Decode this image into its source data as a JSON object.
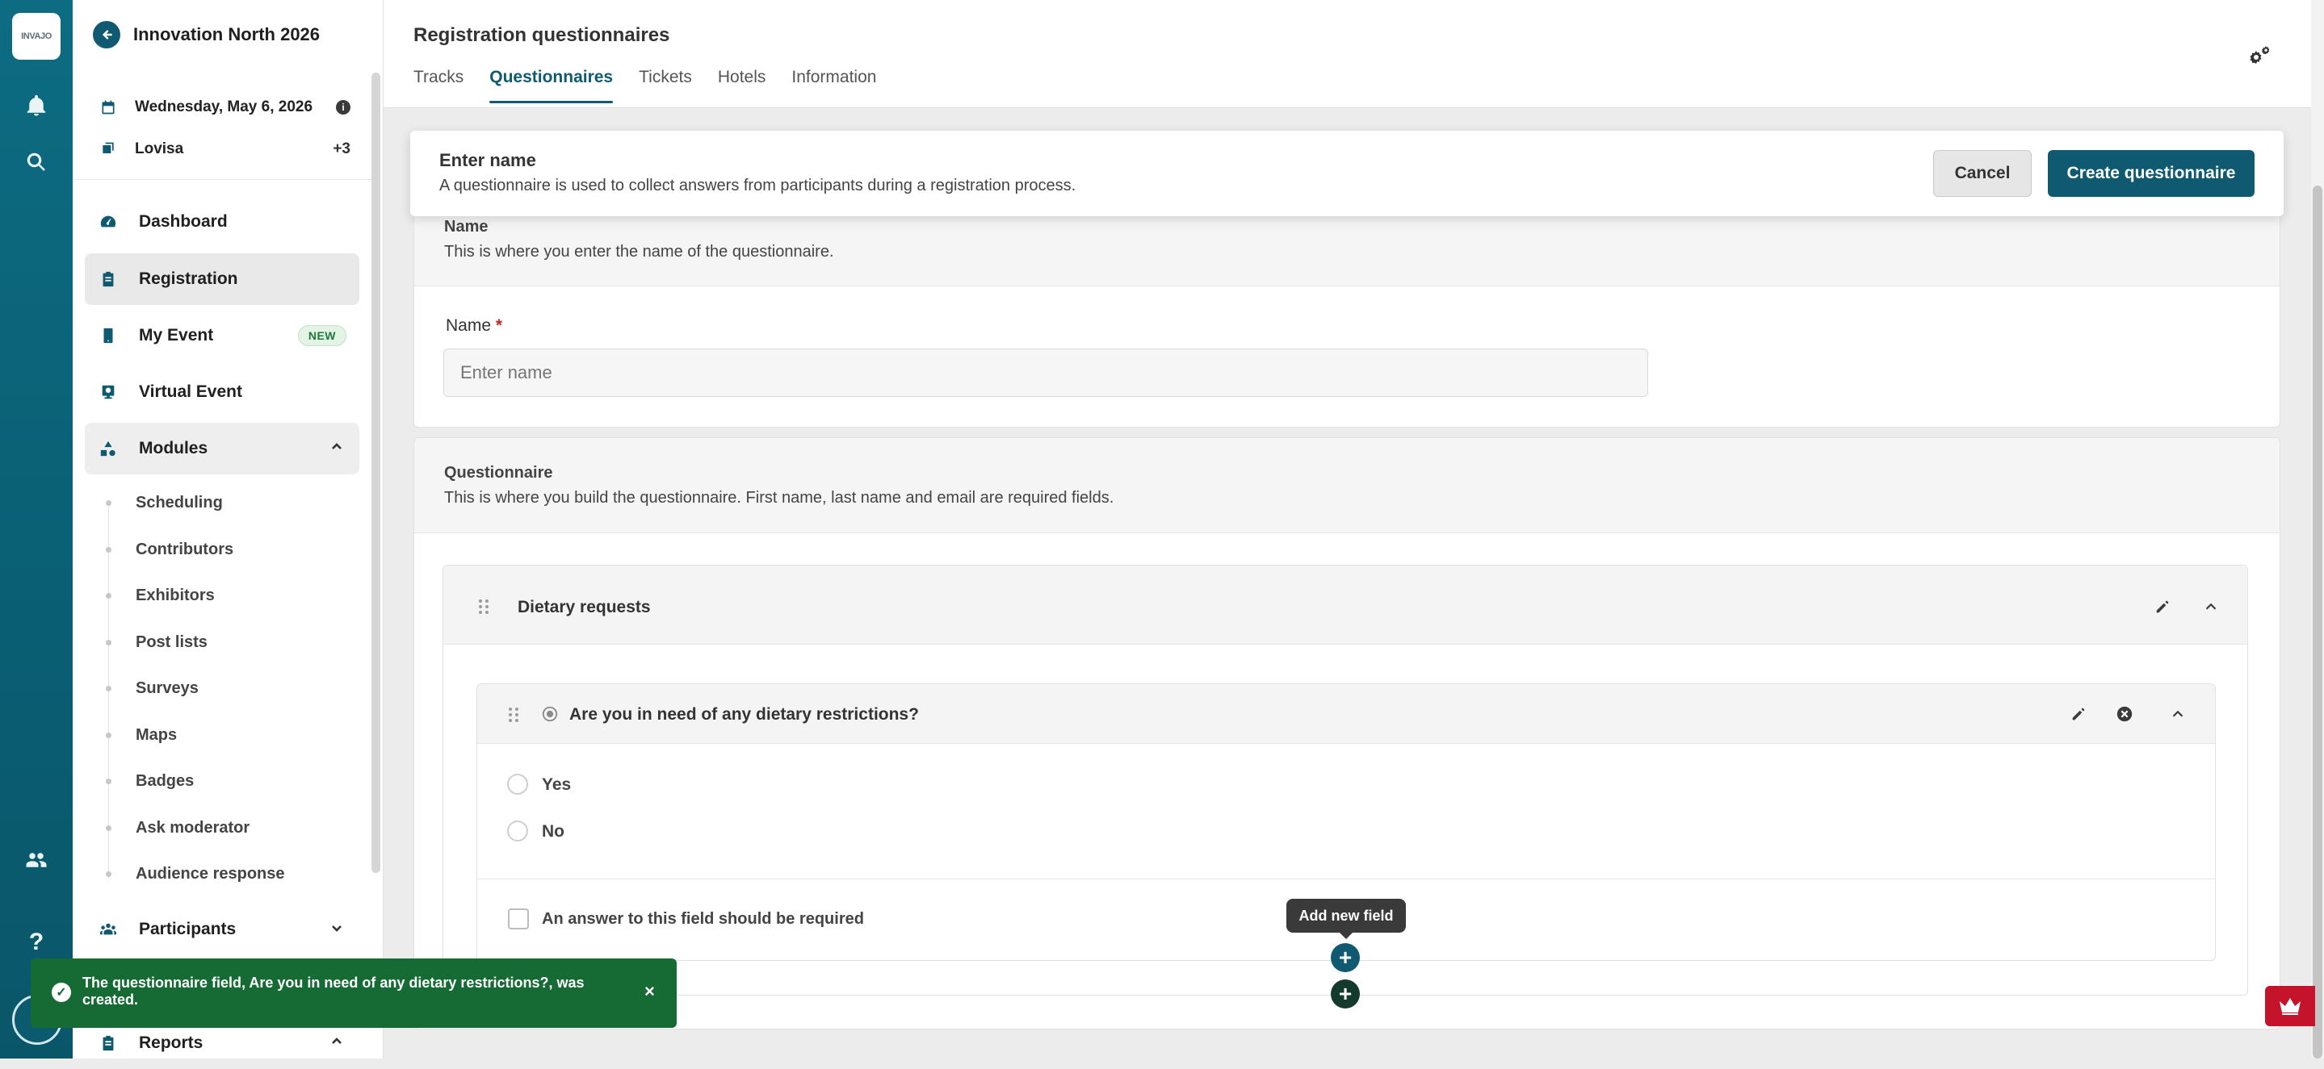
{
  "rail": {
    "logo_text": "INVAJO",
    "icons": [
      "bell-icon",
      "search-icon",
      "people-icon",
      "help-icon",
      "avatar"
    ],
    "help_glyph": "?"
  },
  "sidebar": {
    "event_title": "Innovation North 2026",
    "date": "Wednesday, May 6, 2026",
    "info_glyph": "i",
    "user": "Lovisa",
    "user_extra": "+3",
    "nav": {
      "dashboard": "Dashboard",
      "registration": "Registration",
      "my_event": "My Event",
      "my_event_badge": "NEW",
      "virtual_event": "Virtual Event",
      "modules": "Modules",
      "participants": "Participants",
      "reports": "Reports"
    },
    "modules_items": [
      "Scheduling",
      "Contributors",
      "Exhibitors",
      "Post lists",
      "Surveys",
      "Maps",
      "Badges",
      "Ask moderator",
      "Audience response"
    ]
  },
  "header": {
    "title": "Registration questionnaires",
    "tabs": [
      "Tracks",
      "Questionnaires",
      "Tickets",
      "Hotels",
      "Information"
    ],
    "active_tab": "Questionnaires"
  },
  "sticky": {
    "title": "Enter name",
    "description": "A questionnaire is used to collect answers from participants during a registration process.",
    "cancel_label": "Cancel",
    "create_label": "Create questionnaire"
  },
  "name_section": {
    "title": "Name",
    "description": "This is where you enter the name of the questionnaire.",
    "field_label": "Name",
    "required_mark": "*",
    "placeholder": "Enter name"
  },
  "questionnaire_section": {
    "title": "Questionnaire",
    "description": "This is where you build the questionnaire. First name, last name and email are required fields.",
    "group_title": "Dietary requests",
    "question": "Are you in need of any dietary restrictions?",
    "options": [
      "Yes",
      "No"
    ],
    "required_checkbox_label": "An answer to this field should be required",
    "add_field_tooltip": "Add new field",
    "add_glyph": "+"
  },
  "toast": {
    "message": "The questionnaire field, Are you in need of any dietary restrictions?, was created.",
    "close_glyph": "×",
    "check_glyph": "✓"
  },
  "colors": {
    "brand": "#0f5a70",
    "rail": "#0d6c82",
    "toast": "#166b35",
    "crown": "#c5132b"
  }
}
